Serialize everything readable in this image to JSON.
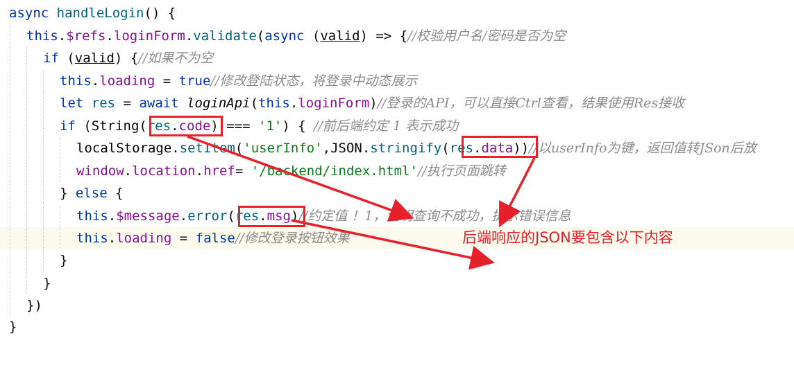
{
  "code": {
    "l1": {
      "k1": "async",
      "fn": "handleLogin",
      "p": "() {"
    },
    "l2": {
      "t": "this",
      "a": ".",
      "r": "$refs",
      "b": ".",
      "f": "loginForm",
      "c": ".",
      "v": "validate",
      "d": "(",
      "k": "async",
      "e": " (",
      "prm": "valid",
      "g": ") => {",
      "cm": "//校验用户名/密码是否为空"
    },
    "l3": {
      "k": "if",
      "a": " (",
      "prm": "valid",
      "b": ") {",
      "cm": "//如果不为空"
    },
    "l4": {
      "t": "this",
      "a": ".",
      "f": "loading",
      "b": " = ",
      "k": "true",
      "cm": "//修改登陆状态，将登录中动态展示"
    },
    "l5": {
      "k": "let",
      "a": " ",
      "v": "res",
      "b": " = ",
      "k2": "await",
      "c": " ",
      "fn": "loginApi",
      "d": "(",
      "t": "this",
      "e": ".",
      "f": "loginForm",
      "g": ")",
      "cm": "//登录的API，可以直接Ctrl查看，结果使用Res接收"
    },
    "l6": {
      "k": "if",
      "a": " (String(",
      "v": "res",
      "b": ".",
      "f": "code",
      "c": ") === ",
      "s": "'1'",
      "d": ") { ",
      "cm": "//前后端约定 1 表示成功"
    },
    "l7": {
      "v": "localStorage",
      "a": ".",
      "fn": "setItem",
      "b": "(",
      "s": "'userInfo'",
      "c": ",JSON.",
      "fn2": "stringify",
      "d": "(",
      "v2": "res",
      "e": ".",
      "f": "data",
      "g": "))",
      "cm": "//以userInfo为键，返回值转JSon后放"
    },
    "l8": {
      "v": "window",
      "a": ".",
      "f": "location",
      "b": ".",
      "f2": "href",
      "c": "= ",
      "s": "'/backend/index.html'",
      "cm": "//执行页面跳转"
    },
    "l9": {
      "a": "} ",
      "k": "else",
      "b": " {"
    },
    "l10": {
      "t": "this",
      "a": ".",
      "f": "$message",
      "b": ".",
      "fn": "error",
      "c": "(",
      "v": "res",
      "d": ".",
      "f2": "msg",
      "e": ")",
      "cm": "//约定值 ！1，说明查询不成功，提示错误信息"
    },
    "l11": {
      "t": "this",
      "a": ".",
      "f": "loading",
      "b": " = ",
      "k": "false",
      "cm": "//修改登录按钮效果"
    },
    "l12": {
      "a": "}"
    },
    "l13": {
      "a": "}"
    },
    "l14": {
      "a": "})"
    },
    "l15": {
      "a": "}"
    }
  },
  "annotation": {
    "note": "后端响应的JSON要包含以下内容",
    "accent": "#e8202a"
  }
}
